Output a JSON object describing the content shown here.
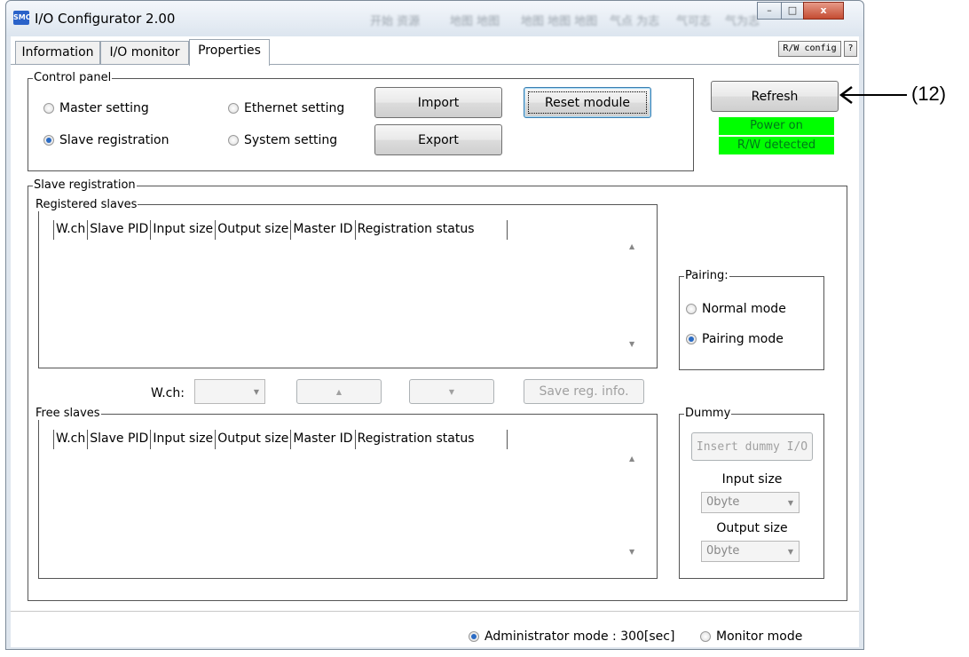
{
  "window": {
    "title": "I/O Configurator 2.00",
    "icon": "app-icon",
    "caption_buttons": {
      "minimize": "–",
      "maximize": "□",
      "close": "x"
    },
    "blurred_background_text": [
      "开始 资源",
      "地图 地图",
      "地图 地图 地图",
      "气点 为志",
      "气可志",
      "气为志"
    ]
  },
  "tabs": [
    {
      "label": "Information"
    },
    {
      "label": "I/O monitor"
    },
    {
      "label": "Properties",
      "active": true
    }
  ],
  "top_right_buttons": {
    "rw_config": "R/W config",
    "help": "?"
  },
  "control_panel": {
    "label": "Control panel",
    "radios": {
      "master": "Master setting",
      "ethernet": "Ethernet setting",
      "slave": "Slave registration",
      "system": "System setting"
    },
    "selected": "Slave registration",
    "import": "Import",
    "export": "Export",
    "reset": "Reset module"
  },
  "refresh": {
    "label": "Refresh"
  },
  "status": {
    "power": "Power on",
    "rw": "R/W detected",
    "color": "#00ff00"
  },
  "slave_registration": {
    "label": "Slave registration",
    "registered": {
      "label": "Registered slaves",
      "columns": [
        "W.ch",
        "Slave PID",
        "Input size",
        "Output size",
        "Master ID",
        "Registration status"
      ]
    },
    "wch_label": "W.ch:",
    "up": "▲",
    "down": "▼",
    "save": "Save reg. info.",
    "free": {
      "label": "Free slaves",
      "columns": [
        "W.ch",
        "Slave PID",
        "Input size",
        "Output size",
        "Master ID",
        "Registration status"
      ]
    }
  },
  "pairing": {
    "label": "Pairing:",
    "normal": "Normal mode",
    "pairing_mode": "Pairing mode",
    "selected": "Pairing mode"
  },
  "dummy": {
    "label": "Dummy",
    "insert": "Insert dummy I/O",
    "input_size_label": "Input size",
    "input_size_value": "0byte",
    "output_size_label": "Output size",
    "output_size_value": "0byte"
  },
  "footer": {
    "admin": "Administrator mode : 300[sec]",
    "monitor": "Monitor mode",
    "selected": "Administrator mode : 300[sec]"
  },
  "annotation": {
    "label": "(12)",
    "arrow": "left-arrow"
  }
}
